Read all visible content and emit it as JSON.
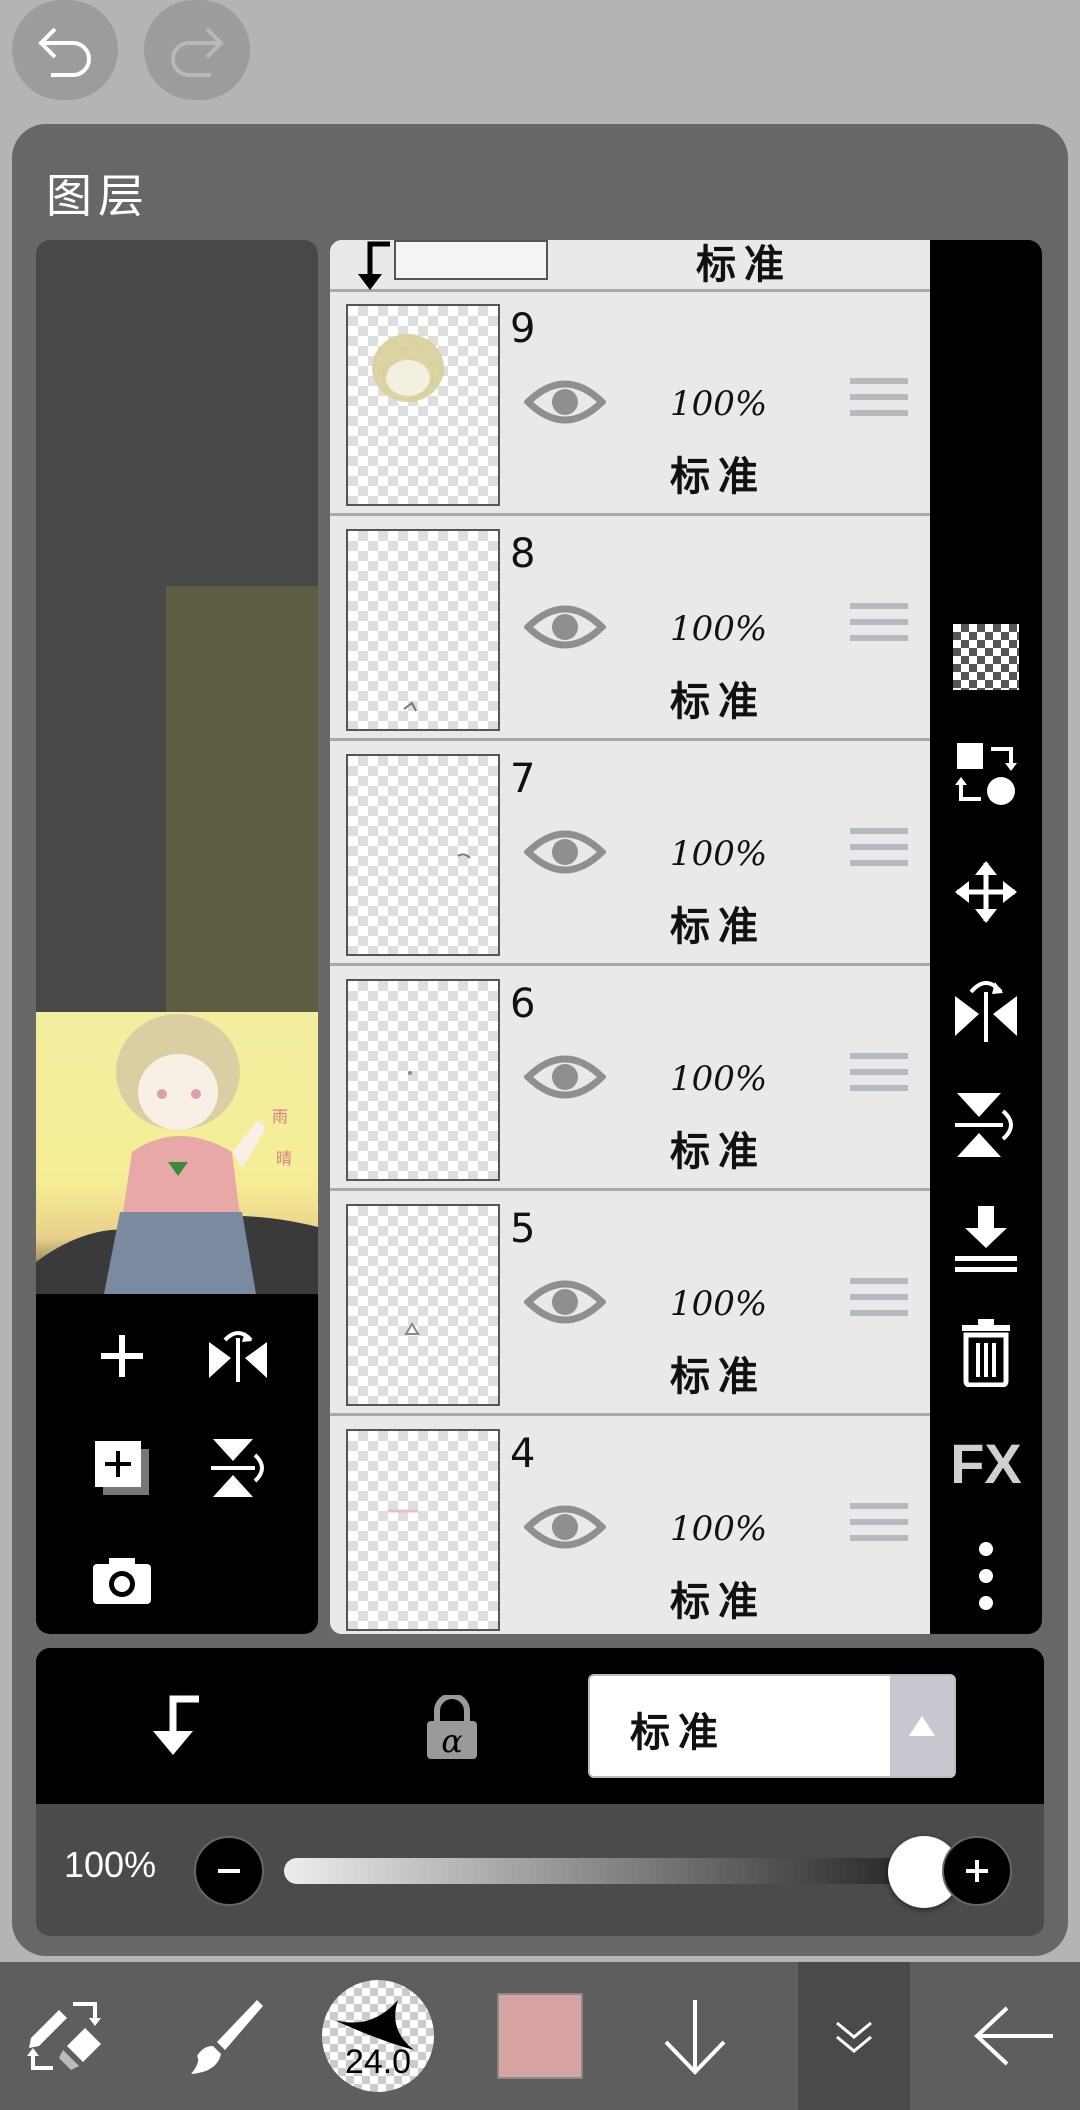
{
  "panel": {
    "title": "图层"
  },
  "partial_layer_top": {
    "mode": "标准"
  },
  "layers": [
    {
      "number": "9",
      "opacity": "100%",
      "mode": "标准"
    },
    {
      "number": "8",
      "opacity": "100%",
      "mode": "标准"
    },
    {
      "number": "7",
      "opacity": "100%",
      "mode": "标准"
    },
    {
      "number": "6",
      "opacity": "100%",
      "mode": "标准"
    },
    {
      "number": "5",
      "opacity": "100%",
      "mode": "标准"
    },
    {
      "number": "4",
      "opacity": "100%",
      "mode": "标准"
    }
  ],
  "right_toolbar": {
    "fx_label": "FX"
  },
  "blend": {
    "selected": "标准"
  },
  "opacity_control": {
    "label": "100%",
    "value": 1.0
  },
  "bottom_toolbar": {
    "brush_size": "24.0",
    "color": "#d8a3a3"
  },
  "colors": {
    "panel": "#676767",
    "list_bg": "#e9e9e9",
    "toolbar_bg": "#000000",
    "accent_color": "#d8a3a3"
  }
}
